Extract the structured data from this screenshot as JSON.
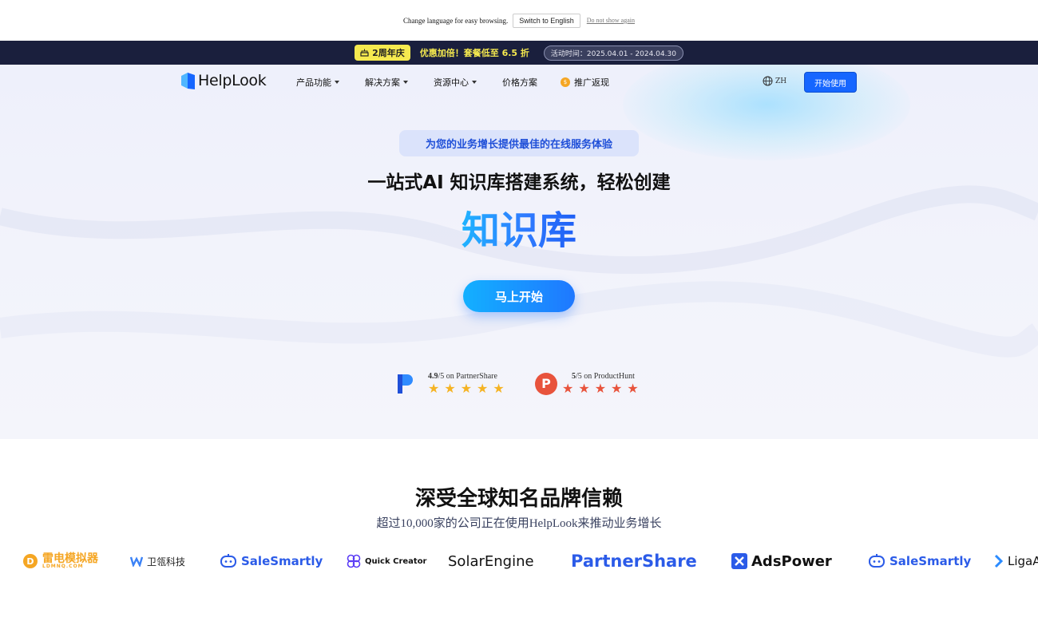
{
  "lang_bar": {
    "prompt": "Change language for easy browsing.",
    "switch_label": "Switch to English",
    "dismiss_label": "Do not show again"
  },
  "promo": {
    "badge": "2周年庆",
    "offer": "优惠加倍！套餐低至 6.5 折",
    "period": "活动时间：2025.04.01 - 2024.04.30"
  },
  "nav": {
    "logo": "HelpLook",
    "items": [
      {
        "label": "产品功能"
      },
      {
        "label": "解决方案"
      },
      {
        "label": "资源中心"
      },
      {
        "label": "价格方案"
      },
      {
        "label": "推广返现"
      }
    ],
    "language": "ZH",
    "cta": "开始使用"
  },
  "hero": {
    "pill": "为您的业务增长提供最佳的在线服务体验",
    "headline": "一站式AI 知识库搭建系统，轻松创建",
    "highlight": "知识库",
    "start_button": "马上开始"
  },
  "ratings": [
    {
      "score": "4.9",
      "suffix": "/5 on PartnerShare",
      "stars": 5,
      "star_color": "#f5b324"
    },
    {
      "score": "5",
      "suffix": "/5 on ProductHunt",
      "stars": 5,
      "star_color": "#e8533c"
    }
  ],
  "trust": {
    "title": "深受全球知名品牌信赖",
    "subtitle": "超过10,000家的公司正在使用HelpLook来推动业务增长",
    "brands": [
      "雷电模拟器",
      "LDMNQ.COM",
      "卫瓴科技",
      "SaleSmartly",
      "Quick Creator",
      "SolarEngine",
      "PartnerShare",
      "AdsPower",
      "SaleSmartly",
      "LigaA"
    ]
  },
  "colors": {
    "accent": "#1666ff",
    "promo_bg": "#1a1f3d",
    "promo_text": "#f5e94f"
  }
}
